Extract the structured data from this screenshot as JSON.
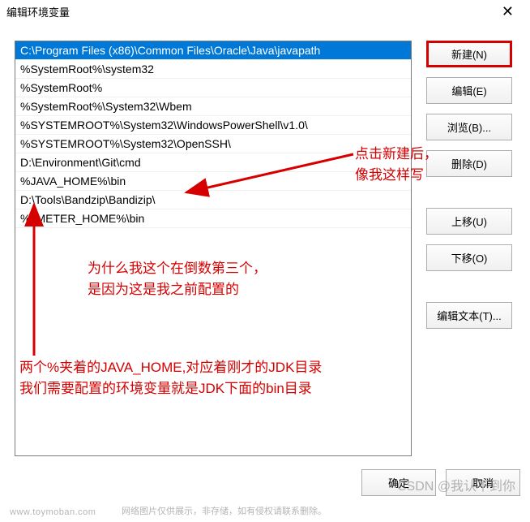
{
  "window": {
    "title": "编辑环境变量",
    "close_glyph": "✕"
  },
  "list": {
    "items": [
      "C:\\Program Files (x86)\\Common Files\\Oracle\\Java\\javapath",
      "%SystemRoot%\\system32",
      "%SystemRoot%",
      "%SystemRoot%\\System32\\Wbem",
      "%SYSTEMROOT%\\System32\\WindowsPowerShell\\v1.0\\",
      "%SYSTEMROOT%\\System32\\OpenSSH\\",
      "D:\\Environment\\Git\\cmd",
      "%JAVA_HOME%\\bin",
      "D:\\Tools\\Bandzip\\Bandizip\\",
      "%JMETER_HOME%\\bin"
    ],
    "selected_index": 0
  },
  "buttons": {
    "new": "新建(N)",
    "edit": "编辑(E)",
    "browse": "浏览(B)...",
    "delete": "删除(D)",
    "move_up": "上移(U)",
    "move_down": "下移(O)",
    "edit_text": "编辑文本(T)...",
    "ok": "确定",
    "cancel": "取消"
  },
  "annotations": {
    "click_new_1": "点击新建后，",
    "click_new_2": "像我这样写",
    "why_third_1": "为什么我这个在倒数第三个，",
    "why_third_2": "是因为这是我之前配置的",
    "bottom_1": "两个%夹着的JAVA_HOME,对应着刚才的JDK目录",
    "bottom_2": "我们需要配置的环境变量就是JDK下面的bin目录"
  },
  "watermark": {
    "left": "www.toymoban.com",
    "note": "网络图片仅供展示，非存储，如有侵权请联系删除。",
    "right": "CSDN @我认不到你"
  }
}
